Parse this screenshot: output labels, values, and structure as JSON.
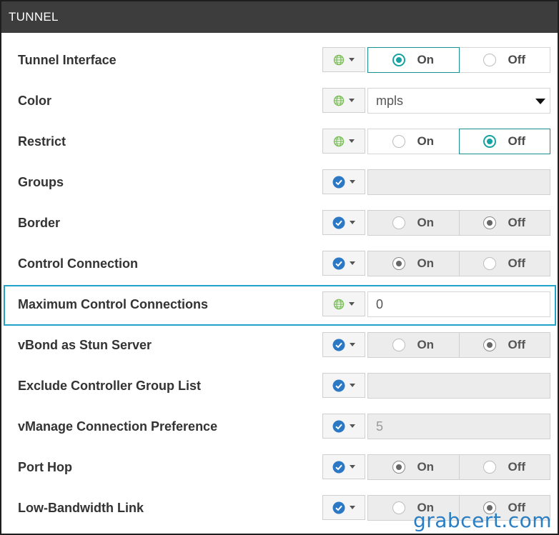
{
  "section": {
    "title": "TUNNEL"
  },
  "fields": [
    {
      "label": "Tunnel Interface",
      "scope": "globe",
      "type": "radio",
      "selected": "On",
      "disabled": false
    },
    {
      "label": "Color",
      "scope": "globe",
      "type": "select",
      "value": "mpls"
    },
    {
      "label": "Restrict",
      "scope": "globe",
      "type": "radio",
      "selected": "Off",
      "disabled": false
    },
    {
      "label": "Groups",
      "scope": "check",
      "type": "text",
      "value": "",
      "disabled": true
    },
    {
      "label": "Border",
      "scope": "check",
      "type": "radio",
      "selected": "Off",
      "disabled": true
    },
    {
      "label": "Control Connection",
      "scope": "check",
      "type": "radio",
      "selected": "On",
      "disabled": true
    },
    {
      "label": "Maximum Control Connections",
      "scope": "globe",
      "type": "text",
      "value": "0",
      "disabled": false,
      "highlighted": true
    },
    {
      "label": "vBond as Stun Server",
      "scope": "check",
      "type": "radio",
      "selected": "Off",
      "disabled": true
    },
    {
      "label": "Exclude Controller Group List",
      "scope": "check",
      "type": "text",
      "value": "",
      "disabled": true
    },
    {
      "label": "vManage Connection Preference",
      "scope": "check",
      "type": "text",
      "value": "5",
      "disabled": true
    },
    {
      "label": "Port Hop",
      "scope": "check",
      "type": "radio",
      "selected": "On",
      "disabled": true
    },
    {
      "label": "Low-Bandwidth Link",
      "scope": "check",
      "type": "radio",
      "selected": "Off",
      "disabled": true
    }
  ],
  "options": {
    "on": "On",
    "off": "Off"
  },
  "icons": {
    "globe": "globe-icon",
    "check": "check-circle-icon",
    "caret": "caret-down-icon",
    "dropdown": "triangle-down-icon"
  },
  "colors": {
    "accent_teal": "#15a3a3",
    "highlight": "#22a2c9",
    "check_blue": "#2b78c5",
    "globe_green": "#7cbf5a",
    "header_bg": "#3d3d3d"
  },
  "watermark": "grabcert.com"
}
